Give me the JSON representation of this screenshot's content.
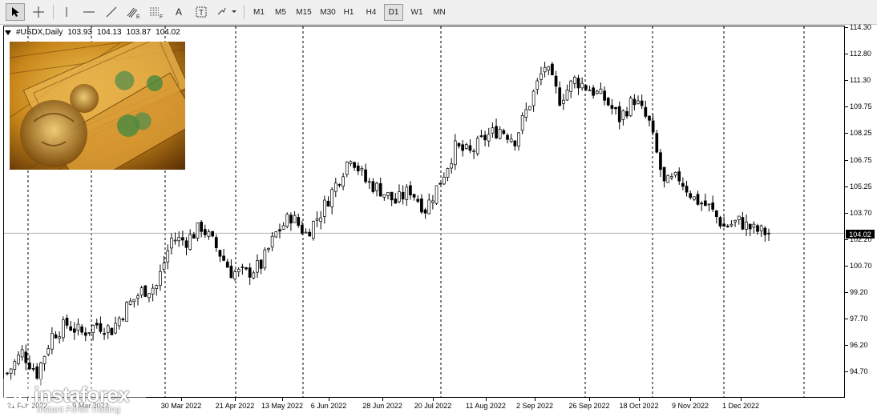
{
  "toolbar": {
    "tools": [
      {
        "name": "cursor-icon"
      },
      {
        "name": "crosshair-icon"
      },
      {
        "name": "vertical-line-icon"
      },
      {
        "name": "horizontal-line-icon"
      },
      {
        "name": "trendline-icon"
      },
      {
        "name": "equidistant-channel-icon"
      },
      {
        "name": "fibonacci-icon"
      },
      {
        "name": "text-icon"
      },
      {
        "name": "text-label-icon"
      },
      {
        "name": "arrows-icon"
      }
    ],
    "tool_letters": {
      "channel": "E",
      "fibo": "F",
      "text": "A",
      "label": "T"
    },
    "timeframes": [
      "M1",
      "M5",
      "M15",
      "M30",
      "H1",
      "H4",
      "D1",
      "W1",
      "MN"
    ],
    "active_timeframe": "D1"
  },
  "chart": {
    "symbol": "#USDX,Daily",
    "open": "103.93",
    "high": "104.13",
    "low": "103.87",
    "close": "104.02",
    "current_price_label": "104.02",
    "price_levels": [
      "114.30",
      "112.80",
      "111.30",
      "109.75",
      "108.25",
      "106.75",
      "105.25",
      "103.70",
      "102.20",
      "100.70",
      "99.20",
      "97.70",
      "96.20",
      "94.70"
    ],
    "date_labels": [
      "21 Feb 2022",
      "9 Mar 2022",
      "30 Mar 2022",
      "21 Apr 2022",
      "13 May 2022",
      "6 Jun 2022",
      "28 Jun 2022",
      "20 Jul 2022",
      "11 Aug 2022",
      "2 Sep 2022",
      "26 Sep 2022",
      "18 Oct 2022",
      "9 Nov 2022",
      "1 Dec 2022"
    ],
    "colors": {
      "background": "#ffffff",
      "candle_up": "#ffffff",
      "candle_down": "#000000",
      "grid": "#000000"
    }
  },
  "watermark": {
    "brand": "instaforex",
    "tagline": "Instant Forex Trading"
  },
  "chart_data": {
    "type": "candlestick",
    "title": "#USDX,Daily",
    "ylim": [
      94.6,
      115.2
    ],
    "y_ticks": [
      114.3,
      112.8,
      111.3,
      109.75,
      108.25,
      106.75,
      105.25,
      103.7,
      102.2,
      100.7,
      99.2,
      97.7,
      96.2,
      94.7
    ],
    "x_ticks": [
      "21 Feb 2022",
      "9 Mar 2022",
      "30 Mar 2022",
      "21 Apr 2022",
      "13 May 2022",
      "6 Jun 2022",
      "28 Jun 2022",
      "20 Jul 2022",
      "11 Aug 2022",
      "2 Sep 2022",
      "26 Sep 2022",
      "18 Oct 2022",
      "9 Nov 2022",
      "1 Dec 2022"
    ],
    "grid": "vertical dashed",
    "close_series": [
      [
        "Feb 2022",
        96.0
      ],
      [
        "Feb 2022",
        97.2
      ],
      [
        "Mar 2022",
        96.0
      ],
      [
        "Mar 2022",
        98.2
      ],
      [
        "Mar 2022",
        98.8
      ],
      [
        "Mar 2022",
        98.3
      ],
      [
        "Mar 2022",
        98.8
      ],
      [
        "Apr 2022",
        98.5
      ],
      [
        "Apr 2022",
        99.8
      ],
      [
        "Apr 2022",
        100.7
      ],
      [
        "Apr 2022",
        101.0
      ],
      [
        "Apr 2022",
        103.7
      ],
      [
        "May 2022",
        103.6
      ],
      [
        "May 2022",
        104.4
      ],
      [
        "May 2022",
        103.2
      ],
      [
        "May 2022",
        101.8
      ],
      [
        "May 2022",
        101.7
      ],
      [
        "Jun 2022",
        102.2
      ],
      [
        "Jun 2022",
        104.0
      ],
      [
        "Jun 2022",
        105.0
      ],
      [
        "Jun 2022",
        104.0
      ],
      [
        "Jun 2022",
        105.2
      ],
      [
        "Jul 2022",
        106.8
      ],
      [
        "Jul 2022",
        108.5
      ],
      [
        "Jul 2022",
        107.0
      ],
      [
        "Jul 2022",
        106.5
      ],
      [
        "Jul 2022",
        105.8
      ],
      [
        "Aug 2022",
        106.5
      ],
      [
        "Aug 2022",
        105.4
      ],
      [
        "Aug 2022",
        107.0
      ],
      [
        "Aug 2022",
        108.9
      ],
      [
        "Aug 2022",
        108.6
      ],
      [
        "Sep 2022",
        109.5
      ],
      [
        "Sep 2022",
        110.0
      ],
      [
        "Sep 2022",
        109.4
      ],
      [
        "Sep 2022",
        111.5
      ],
      [
        "Sep 2022",
        113.6
      ],
      [
        "Oct 2022",
        111.7
      ],
      [
        "Oct 2022",
        112.8
      ],
      [
        "Oct 2022",
        112.3
      ],
      [
        "Oct 2022",
        111.7
      ],
      [
        "Oct 2022",
        110.6
      ],
      [
        "Nov 2022",
        111.7
      ],
      [
        "Nov 2022",
        110.3
      ],
      [
        "Nov 2022",
        106.8
      ],
      [
        "Nov 2022",
        107.2
      ],
      [
        "Nov 2022",
        106.0
      ],
      [
        "Dec 2022",
        105.5
      ],
      [
        "Dec 2022",
        104.4
      ],
      [
        "Dec 2022",
        104.7
      ],
      [
        "Dec 2022",
        104.2
      ],
      [
        "Dec 2022",
        104.02
      ]
    ],
    "last": 104.02
  }
}
